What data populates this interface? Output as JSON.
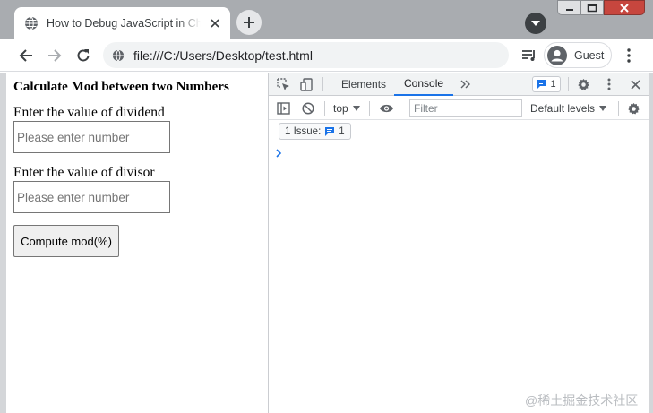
{
  "browser": {
    "tab": {
      "title": "How to Debug JavaScript in Chrome",
      "favicon": "globe-icon"
    },
    "profile": {
      "label": "Guest"
    },
    "address": {
      "url": "file:///C:/Users/Desktop/test.html",
      "icon": "globe-icon"
    }
  },
  "page": {
    "heading": "Calculate Mod between two Numbers",
    "dividend": {
      "label": "Enter the value of dividend",
      "placeholder": "Please enter number",
      "value": ""
    },
    "divisor": {
      "label": "Enter the value of divisor",
      "placeholder": "Please enter number",
      "value": ""
    },
    "button_label": "Compute mod(%)"
  },
  "devtools": {
    "tabs": [
      {
        "label": "Elements",
        "active": false
      },
      {
        "label": "Console",
        "active": true
      }
    ],
    "issue_badge_count": "1",
    "context": "top",
    "filter_placeholder": "Filter",
    "levels": "Default levels",
    "issues_chip": {
      "label": "1 Issue:",
      "count": "1"
    },
    "accent_color": "#1a73e8"
  },
  "watermark": "@稀土掘金技术社区"
}
